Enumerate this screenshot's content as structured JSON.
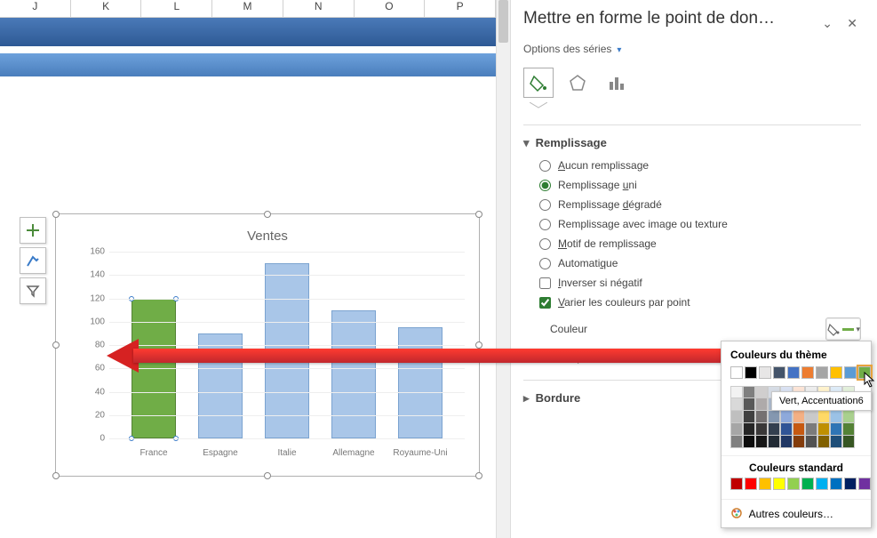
{
  "columns": [
    "J",
    "K",
    "L",
    "M",
    "N",
    "O",
    "P"
  ],
  "chart_tools": [
    "plus",
    "brush",
    "funnel"
  ],
  "chart_data": {
    "type": "bar",
    "title": "Ventes",
    "categories": [
      "France",
      "Espagne",
      "Italie",
      "Allemagne",
      "Royaume-Uni"
    ],
    "values": [
      120,
      90,
      150,
      110,
      95
    ],
    "ylim": [
      0,
      160
    ],
    "ystep": 20,
    "selected_index": 0,
    "selected_color": "#70ad47"
  },
  "panel": {
    "title": "Mettre en forme le point de don…",
    "series_dropdown": "Options des séries",
    "tabs": [
      "fill-icon",
      "pentagon-icon",
      "bars-icon"
    ],
    "active_tab": 0,
    "sections": {
      "fill": {
        "label": "Remplissage",
        "expanded": true
      },
      "border": {
        "label": "Bordure",
        "expanded": false
      }
    },
    "fill_options": [
      {
        "id": "none",
        "label_pre": "",
        "u": "A",
        "label_post": "ucun remplissage",
        "type": "radio",
        "checked": false
      },
      {
        "id": "solid",
        "label_pre": "Remplissage ",
        "u": "u",
        "label_post": "ni",
        "type": "radio",
        "checked": true
      },
      {
        "id": "grad",
        "label_pre": "Remplissage ",
        "u": "d",
        "label_post": "égradé",
        "type": "radio",
        "checked": false
      },
      {
        "id": "pic",
        "label_pre": "Remplissage avec image ou texture",
        "u": "",
        "label_post": "",
        "type": "radio",
        "checked": false
      },
      {
        "id": "pat",
        "label_pre": "",
        "u": "M",
        "label_post": "otif de remplissage",
        "type": "radio",
        "checked": false
      },
      {
        "id": "auto",
        "label_pre": "Automati",
        "u": "q",
        "label_post": "ue",
        "type": "radio",
        "checked": false
      },
      {
        "id": "invert",
        "label_pre": "",
        "u": "I",
        "label_post": "nverser si négatif",
        "type": "check",
        "checked": false
      },
      {
        "id": "vary",
        "label_pre": "",
        "u": "V",
        "label_post": "arier les couleurs par point",
        "type": "check",
        "checked": true
      }
    ],
    "color_label": "Couleur",
    "transparency_label": "Transparence"
  },
  "color_popup": {
    "theme_label": "Couleurs du thème",
    "theme_row": [
      "#ffffff",
      "#000000",
      "#e7e6e6",
      "#44546a",
      "#4472c4",
      "#ed7d31",
      "#a5a5a5",
      "#ffc000",
      "#5b9bd5",
      "#70ad47"
    ],
    "theme_shades": [
      [
        "#f2f2f2",
        "#7f7f7f",
        "#d0cece",
        "#d6dce5",
        "#d9e1f2",
        "#fce4d6",
        "#ededed",
        "#fff2cc",
        "#ddebf7",
        "#e2efda"
      ],
      [
        "#d9d9d9",
        "#595959",
        "#aeaaaa",
        "#acb9ca",
        "#b4c6e7",
        "#f8cbad",
        "#dbdbdb",
        "#ffe699",
        "#bdd7ee",
        "#c6e0b4"
      ],
      [
        "#bfbfbf",
        "#404040",
        "#757171",
        "#8497b0",
        "#8ea9db",
        "#f4b084",
        "#c9c9c9",
        "#ffd966",
        "#9bc2e6",
        "#a9d08e"
      ],
      [
        "#a6a6a6",
        "#262626",
        "#3a3838",
        "#333f4f",
        "#305496",
        "#c65911",
        "#7b7b7b",
        "#bf8f00",
        "#2f75b5",
        "#548235"
      ],
      [
        "#808080",
        "#0d0d0d",
        "#161616",
        "#222b35",
        "#203764",
        "#833c0c",
        "#525252",
        "#806000",
        "#1f4e78",
        "#375623"
      ]
    ],
    "standard_label": "Couleurs standard",
    "standard": [
      "#c00000",
      "#ff0000",
      "#ffc000",
      "#ffff00",
      "#92d050",
      "#00b050",
      "#00b0f0",
      "#0070c0",
      "#002060",
      "#7030a0"
    ],
    "more_label": "Autres couleurs…",
    "hover_tooltip": "Vert, Accentuation6"
  }
}
